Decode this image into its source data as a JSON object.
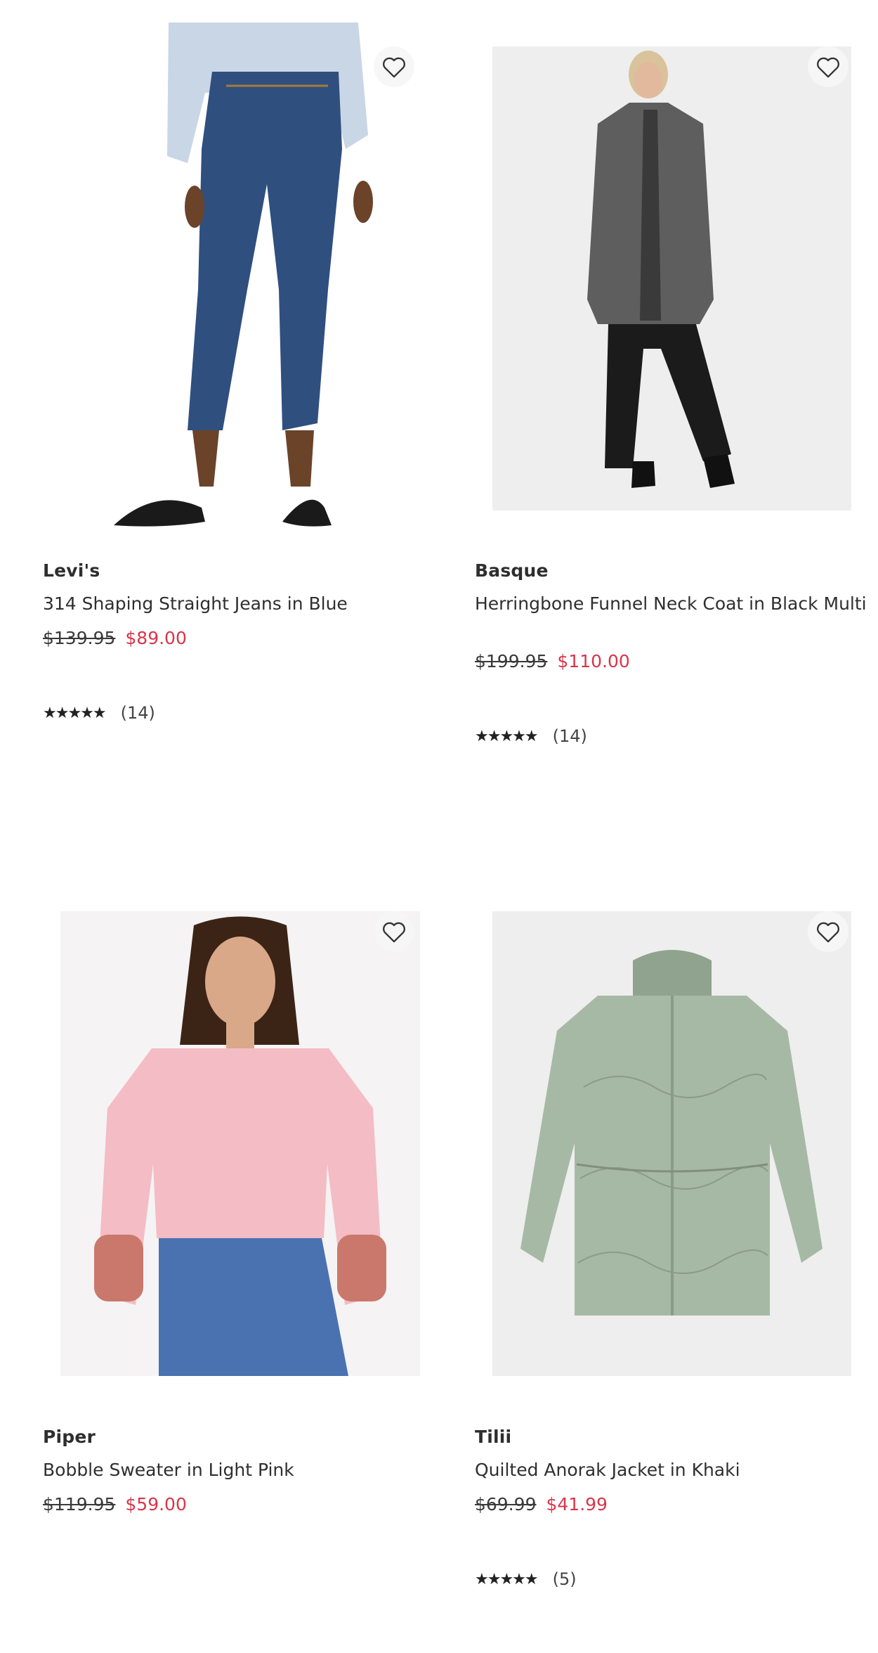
{
  "colors": {
    "sale_price": "#d8354b",
    "text": "#2f2f2f",
    "star": "#222222"
  },
  "products": [
    {
      "brand": "Levi's",
      "title": "314 Shaping Straight Jeans in Blue",
      "price_was": "$139.95",
      "price_now": "$89.00",
      "rating_value": 4.5,
      "stars": "★★★★★",
      "review_count": "(14)",
      "wishlist_icon": "heart-outline-icon",
      "image": "woman-in-blue-jeans"
    },
    {
      "brand": "Basque",
      "title": "Herringbone Funnel Neck Coat in Black Multi",
      "price_was": "$199.95",
      "price_now": "$110.00",
      "rating_value": 5,
      "stars": "★★★★★",
      "review_count": "(14)",
      "wishlist_icon": "heart-outline-icon",
      "image": "woman-in-grey-coat"
    },
    {
      "brand": "Piper",
      "title": "Bobble Sweater in Light Pink",
      "price_was": "$119.95",
      "price_now": "$59.00",
      "wishlist_icon": "heart-outline-icon",
      "image": "woman-in-pink-sweater"
    },
    {
      "brand": "Tilii",
      "title": "Quilted Anorak Jacket in Khaki",
      "price_was": "$69.99",
      "price_now": "$41.99",
      "rating_value": 5,
      "stars": "★★★★★",
      "review_count": "(5)",
      "wishlist_icon": "heart-outline-icon",
      "image": "khaki-quilted-jacket"
    }
  ]
}
